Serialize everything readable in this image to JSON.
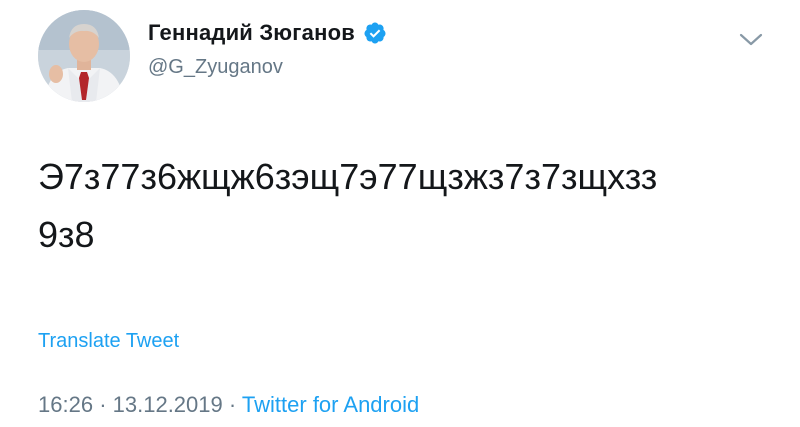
{
  "tweet": {
    "author": {
      "display_name": "Геннадий Зюганов",
      "handle": "@G_Zyuganov",
      "verified": true
    },
    "text_lines": [
      "Э7з77з6жщж6зэщ7э77щзжз7з7зщхзз",
      "9з8"
    ],
    "translate_label": "Translate Tweet",
    "time": "16:26",
    "separator": "·",
    "date": "13.12.2019",
    "source": "Twitter for Android"
  },
  "icons": {
    "verified": "verified-badge-icon",
    "menu": "chevron-down-icon"
  },
  "colors": {
    "text": "#14171a",
    "secondary": "#657786",
    "accent": "#1da1f2"
  }
}
